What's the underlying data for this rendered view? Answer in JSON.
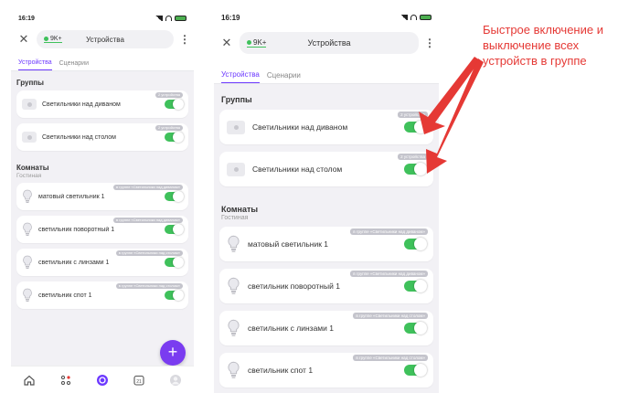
{
  "status": {
    "time": "16:19"
  },
  "header": {
    "account": "9K+",
    "title": "Устройства",
    "close_icon": "close-icon",
    "menu_icon": "more-vertical-icon"
  },
  "tabs": [
    {
      "label": "Устройства",
      "active": true
    },
    {
      "label": "Сценарии",
      "active": false
    }
  ],
  "groups": {
    "label": "Группы",
    "items": [
      {
        "name": "Светильники над диваном",
        "tag": "2 устройства",
        "on": true
      },
      {
        "name": "Светильники над столом",
        "tag": "2 устройства",
        "on": true
      }
    ]
  },
  "rooms": {
    "label": "Комнаты",
    "room": "Гостиная",
    "items": [
      {
        "name": "матовый светильник 1",
        "tag": "в группе «Светильники над диваном»",
        "on": true
      },
      {
        "name": "светильник поворотный 1",
        "tag": "в группе «Светильники над диваном»",
        "on": true
      },
      {
        "name": "светильник с линзами 1",
        "tag": "в группе «Светильники над столом»",
        "on": true
      },
      {
        "name": "светильник спот 1",
        "tag": "в группе «Светильники над столом»",
        "on": true
      }
    ]
  },
  "fab": {
    "label": "+"
  },
  "bottom_nav": [
    "home-icon",
    "devices-icon",
    "alice-icon",
    "calendar-icon",
    "profile-icon"
  ],
  "annotation": {
    "text": "Быстрое включение и выключение всех устройств в группе",
    "color": "#e53935"
  },
  "colors": {
    "accent": "#6c38ff",
    "toggle_on": "#3fc15b",
    "fab": "#7a3cf0"
  }
}
